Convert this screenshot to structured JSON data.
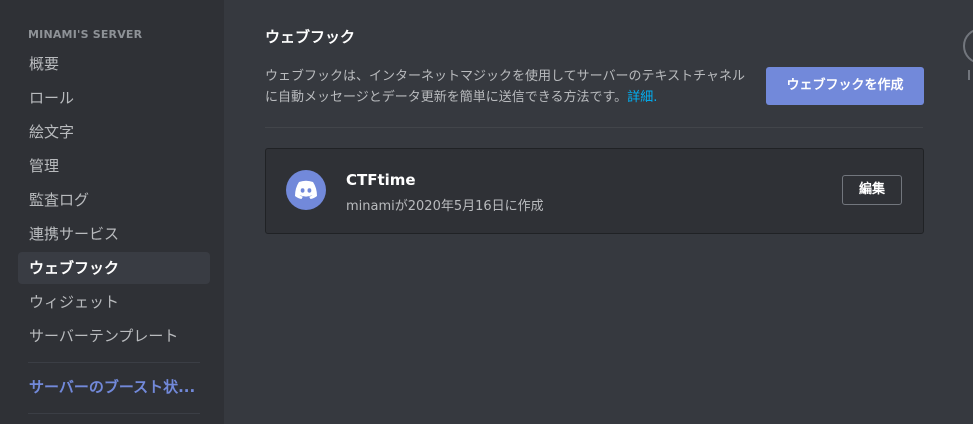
{
  "sidebar": {
    "server_name": "MINAMI'S SERVER",
    "items": [
      {
        "label": "概要"
      },
      {
        "label": "ロール"
      },
      {
        "label": "絵文字"
      },
      {
        "label": "管理"
      },
      {
        "label": "監査ログ"
      },
      {
        "label": "連携サービス"
      },
      {
        "label": "ウェブフック",
        "active": true
      },
      {
        "label": "ウィジェット"
      },
      {
        "label": "サーバーテンプレート"
      }
    ],
    "boost_label": "サーバーのブースト状..."
  },
  "main": {
    "title": "ウェブフック",
    "description": "ウェブフックは、インターネットマジックを使用してサーバーのテキストチャネルに自動メッセージとデータ更新を簡単に送信できる方法です。",
    "details_link": "詳細.",
    "create_button": "ウェブフックを作成",
    "webhooks": [
      {
        "name": "CTFtime",
        "meta": "minamiが2020年5月16日に作成",
        "edit_label": "編集",
        "avatar_icon": "discord-logo-icon"
      }
    ]
  },
  "colors": {
    "accent": "#7289da",
    "link": "#00b0f4",
    "background": "#36393f",
    "sidebar": "#2f3136"
  }
}
